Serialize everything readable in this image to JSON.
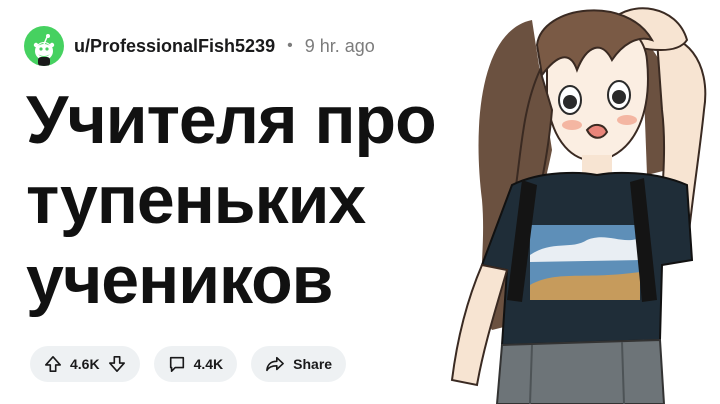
{
  "post": {
    "username": "u/ProfessionalFish5239",
    "separator": "•",
    "time": "9 hr. ago",
    "title_lines": [
      "Учителя про",
      "тупеньких",
      "учеников"
    ]
  },
  "actions": {
    "upvotes": "4.6K",
    "comments": "4.4K",
    "share_label": "Share"
  },
  "icons": {
    "avatar": "snoo-avatar-icon",
    "upvote": "upvote-arrow-icon",
    "downvote": "downvote-arrow-icon",
    "comment": "comment-bubble-icon",
    "share": "share-arrow-icon"
  },
  "colors": {
    "avatar_bg": "#46d160",
    "pill_bg": "#eef1f3",
    "muted_text": "#7c7c7c"
  }
}
